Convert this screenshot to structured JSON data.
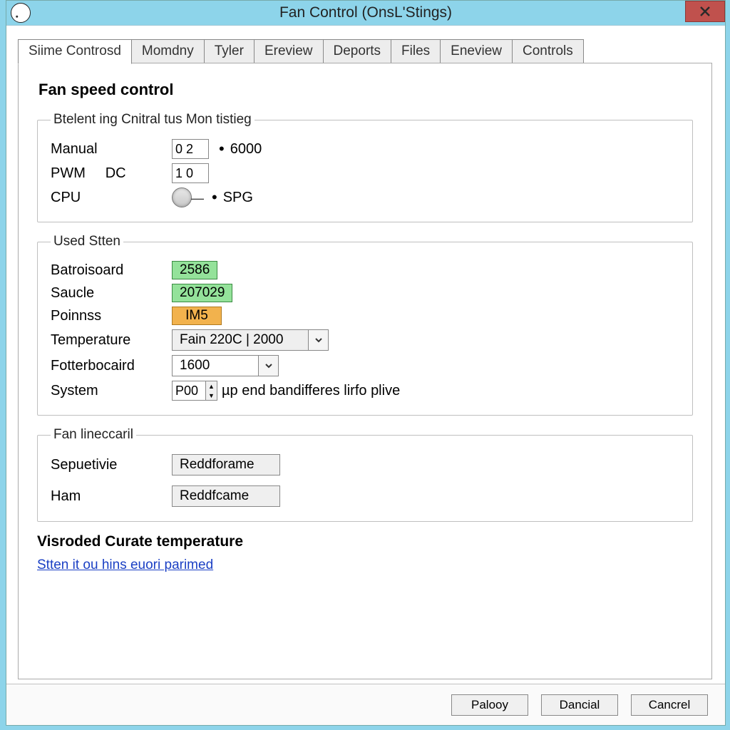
{
  "window": {
    "title": "Fan Control (OnsL'Stings)"
  },
  "tabs": [
    {
      "label": "Siime Controsd"
    },
    {
      "label": "Momdny"
    },
    {
      "label": "Tyler"
    },
    {
      "label": "Ereview"
    },
    {
      "label": "Deports"
    },
    {
      "label": "Files"
    },
    {
      "label": "Eneview"
    },
    {
      "label": "Controls"
    }
  ],
  "heading": "Fan speed control",
  "group1": {
    "legend": "Btelent ing Cnitral tus Mon tistieg",
    "manual_label": "Manual",
    "manual_value": "0 2",
    "manual_after": "6000",
    "pwm_label": "PWM",
    "dc_label": "DC",
    "pwm_value": "1 0",
    "cpu_label": "CPU",
    "cpu_after": "SPG"
  },
  "group2": {
    "legend": "Used Stten",
    "batroisoard_label": "Batroisoard",
    "batroisoard_value": "2586",
    "saucle_label": "Saucle",
    "saucle_value": "207029",
    "poinnss_label": "Poinnss",
    "poinnss_value": "IM5",
    "temperature_label": "Temperature",
    "temperature_value": "Fain 220C | 2000",
    "fotter_label": "Fotterbocaird",
    "fotter_value": "1600",
    "system_label": "System",
    "system_value": "P00",
    "system_after": "µp end bandifferes lirfo plive"
  },
  "group3": {
    "legend": "Fan lineccaril",
    "sepuetivie_label": "Sepuetivie",
    "sepuetivie_value": "Reddforame",
    "ham_label": "Ham",
    "ham_value": "Reddfcame"
  },
  "subheading": "Visroded Curate temperature",
  "link_text": "Stten it ou hins euori parimed",
  "buttons": {
    "ok": "Palooy",
    "apply": "Dancial",
    "cancel": "Cancrel"
  }
}
